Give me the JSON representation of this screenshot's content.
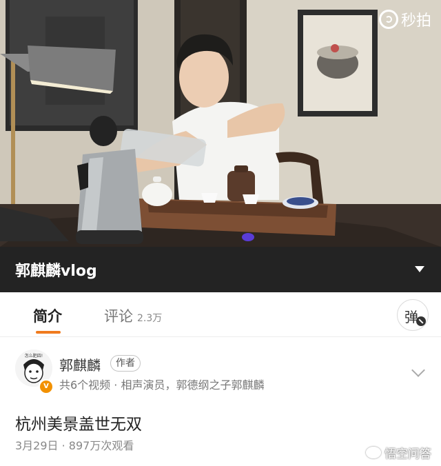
{
  "video": {
    "watermark_icon": "miaopai-logo-icon",
    "watermark_text": "秒拍"
  },
  "titlebar": {
    "title": "郭麒麟vlog",
    "caret_icon": "caret-down-icon"
  },
  "tabs": {
    "intro_label": "简介",
    "comments_label": "评论",
    "comments_count": "2.3万",
    "danmu_label": "弹",
    "accent_color": "#f07b1e"
  },
  "author": {
    "name": "郭麒麟",
    "tag": "作者",
    "description": "共6个视频 · 相声演员，郭德纲之子郭麒麟",
    "avatar_caption": "怎么肥四!",
    "verified_badge": "V"
  },
  "post": {
    "title": "杭州美景盖世无双",
    "meta": "3月29日 · 897万次观看"
  },
  "footer_watermark": "悟空问答"
}
